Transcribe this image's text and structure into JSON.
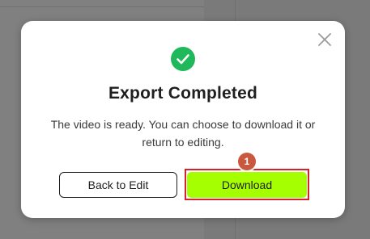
{
  "dialog": {
    "title": "Export Completed",
    "message": "The video is ready. You can choose to download it or return to editing.",
    "close_icon": "close-icon",
    "status_icon": "check-circle-icon",
    "status_color": "#1fb85a",
    "back_button_label": "Back to Edit",
    "download_button_label": "Download",
    "download_button_color": "#a6ff00",
    "highlight_color": "#d91f2b",
    "step_badge": "1",
    "step_badge_color": "#c9583f"
  }
}
